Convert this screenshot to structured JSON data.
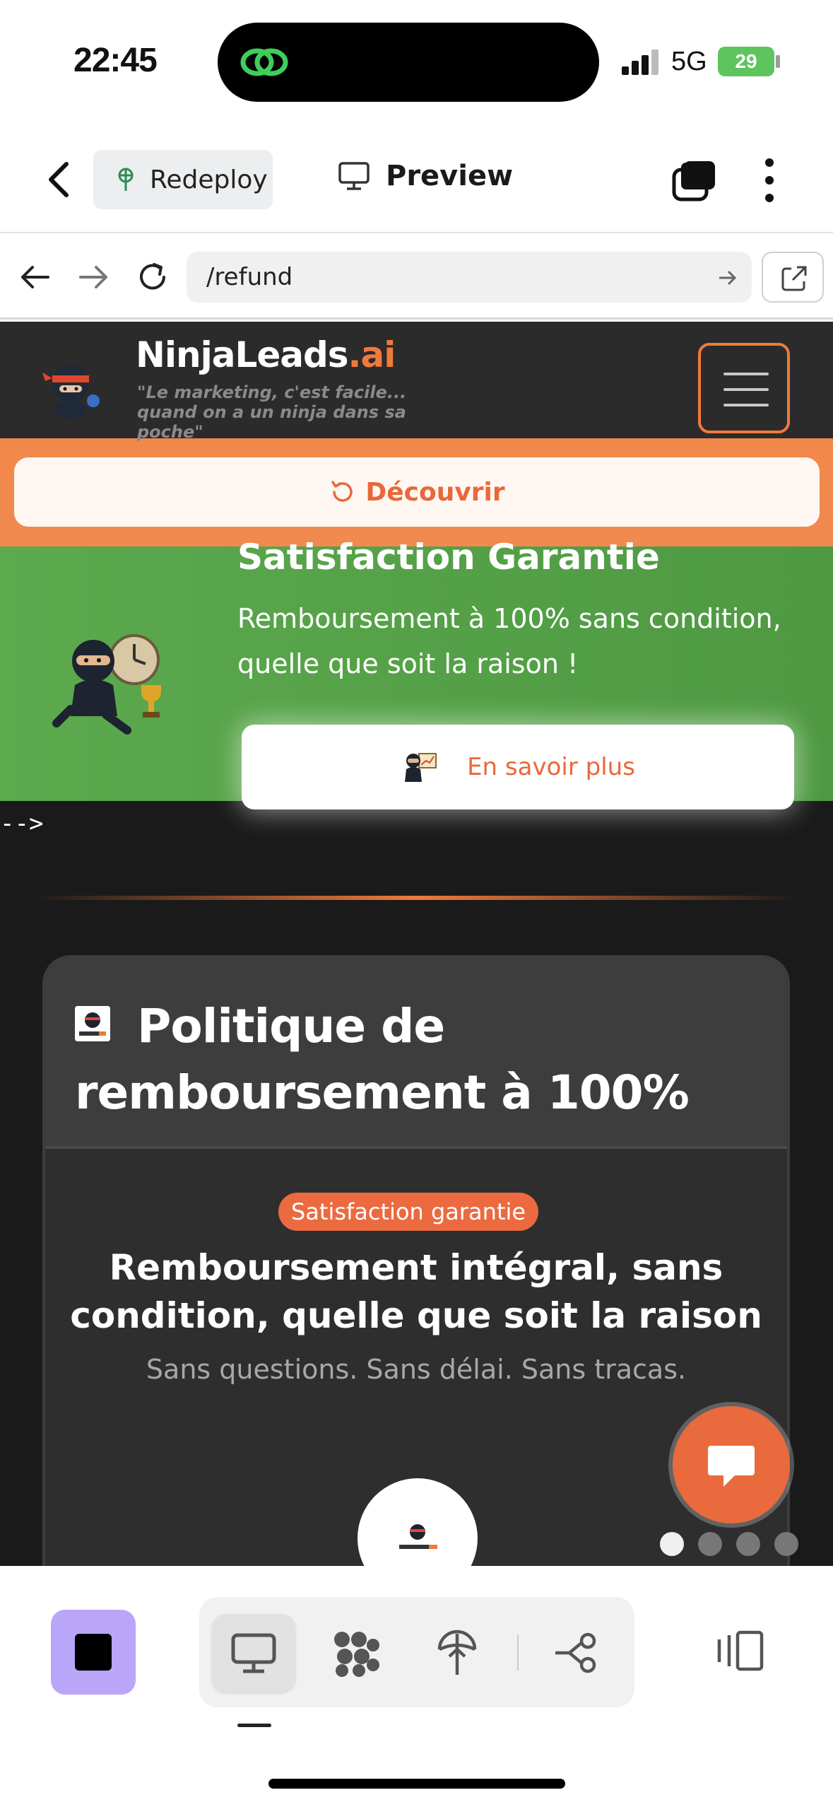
{
  "status": {
    "time": "22:45",
    "network": "5G",
    "battery": "29"
  },
  "app_header": {
    "redeploy_label": "Redeploy",
    "preview_label": "Preview"
  },
  "browser": {
    "url": "/refund"
  },
  "site": {
    "brand_main": "NinjaLeads",
    "brand_suffix": ".ai",
    "tagline": "\"Le marketing, c'est facile... quand on a un ninja dans sa poche\"",
    "discover_label": "Découvrir",
    "satisfaction": {
      "title": "Satisfaction Garantie",
      "text": "Remboursement à 100% sans condition, quelle que soit la raison !",
      "button": "En savoir plus"
    },
    "stray_text": "-->",
    "policy": {
      "title": "Politique de remboursement à 100%",
      "badge": "Satisfaction garantie",
      "heading": "Remboursement intégral, sans condition, quelle que soit la raison",
      "subtext": "Sans questions. Sans délai. Sans tracas."
    },
    "carousel": {
      "total": 4,
      "active": 1
    }
  },
  "colors": {
    "accent": "#ec6a3f",
    "green": "#5ca94e",
    "dark": "#1a1a1a",
    "stop_button": "#b9a6f9"
  },
  "icons": [
    "back-chevron-icon",
    "redeploy-icon",
    "monitor-icon",
    "tabs-icon",
    "more-icon",
    "back-arrow-icon",
    "forward-arrow-icon",
    "reload-icon",
    "go-arrow-icon",
    "external-link-icon",
    "menu-icon",
    "refresh-icon",
    "chat-icon",
    "stop-icon",
    "grid-icon",
    "deploy-icon",
    "share-icon",
    "sidebar-icon"
  ]
}
